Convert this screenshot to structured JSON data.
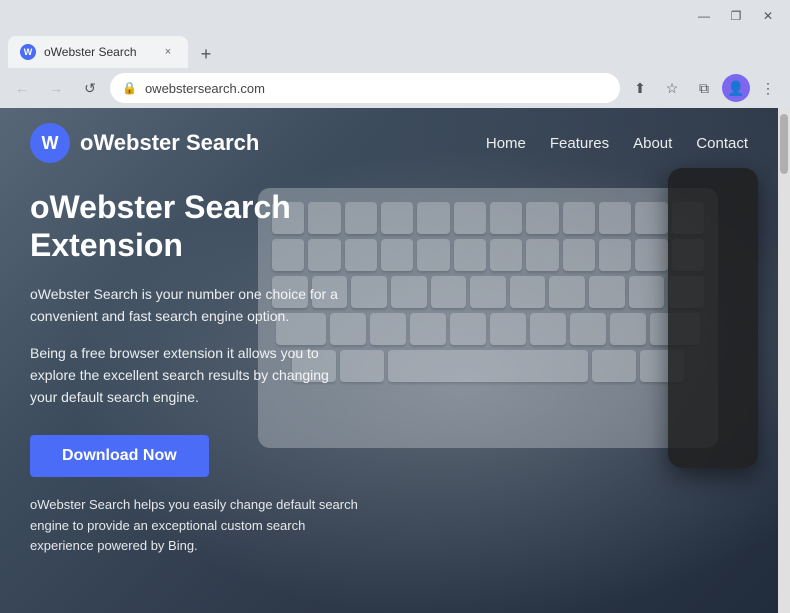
{
  "browser": {
    "title": "oWebster Search",
    "tab_close": "×",
    "new_tab": "+",
    "win_min": "—",
    "win_max": "❐",
    "win_close": "✕",
    "nav_back": "←",
    "nav_forward": "→",
    "nav_reload": "↺",
    "url": "owebstersearch.com",
    "lock_icon": "🔒",
    "share_icon": "⬆",
    "star_icon": "☆",
    "tab_icon": "⧉",
    "profile_icon": "👤",
    "menu_icon": "⋮"
  },
  "site": {
    "logo_letter": "W",
    "logo_text": "oWebster Search",
    "nav": {
      "home": "Home",
      "features": "Features",
      "about": "About",
      "contact": "Contact"
    },
    "hero": {
      "title_line1": "oWebster Search",
      "title_line2": "Extension",
      "desc1": "oWebster Search is your number one choice for a convenient and fast search engine option.",
      "desc2": "Being a free browser extension it allows you to explore the excellent search results by changing your default search engine.",
      "download_btn": "Download Now",
      "footer_text": "oWebster Search helps you easily change default search engine to provide an exceptional custom search experience powered by Bing."
    }
  }
}
